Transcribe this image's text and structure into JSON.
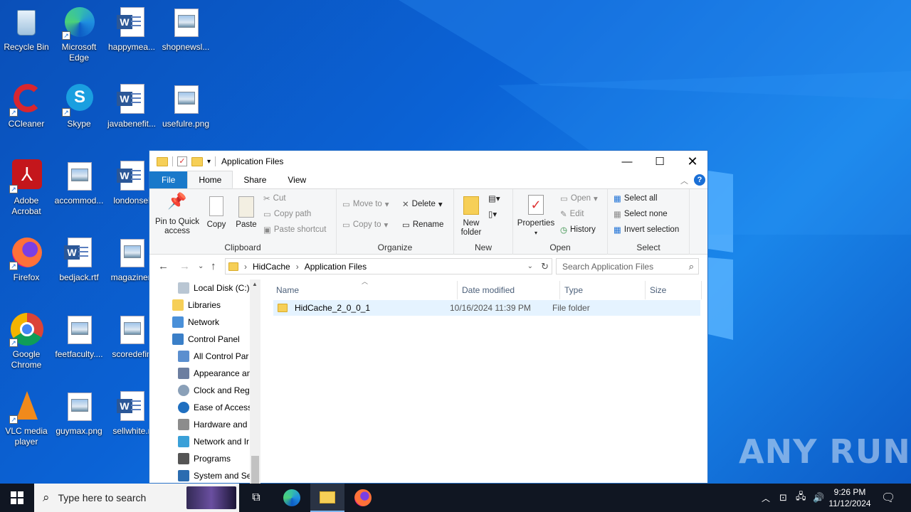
{
  "desktop": {
    "icons": [
      {
        "label": "Recycle Bin"
      },
      {
        "label": "Microsoft Edge"
      },
      {
        "label": "happymea..."
      },
      {
        "label": "shopnewsl..."
      },
      {
        "label": "CCleaner"
      },
      {
        "label": "Skype"
      },
      {
        "label": "javabenefit..."
      },
      {
        "label": "usefulre.png"
      },
      {
        "label": "Adobe Acrobat"
      },
      {
        "label": "accommod..."
      },
      {
        "label": "londonsel"
      },
      {
        "label": "Firefox"
      },
      {
        "label": "bedjack.rtf"
      },
      {
        "label": "magazinen"
      },
      {
        "label": "Google Chrome"
      },
      {
        "label": "feetfaculty...."
      },
      {
        "label": "scoredefin"
      },
      {
        "label": "VLC media player"
      },
      {
        "label": "guymax.png"
      },
      {
        "label": "sellwhite.r"
      }
    ],
    "watermark": "ANY RUN"
  },
  "window": {
    "title": "Application Files",
    "tabs": [
      {
        "label": "File"
      },
      {
        "label": "Home"
      },
      {
        "label": "Share"
      },
      {
        "label": "View"
      }
    ],
    "ribbon": {
      "clipboard": {
        "pin": "Pin to Quick access",
        "copy": "Copy",
        "paste": "Paste",
        "cut": "Cut",
        "copy_path": "Copy path",
        "paste_shortcut": "Paste shortcut",
        "label": "Clipboard"
      },
      "organize": {
        "move_to": "Move to",
        "copy_to": "Copy to",
        "delete": "Delete",
        "rename": "Rename",
        "label": "Organize"
      },
      "new": {
        "new_folder": "New folder",
        "label": "New"
      },
      "open": {
        "properties": "Properties",
        "open": "Open",
        "edit": "Edit",
        "history": "History",
        "label": "Open"
      },
      "select": {
        "select_all": "Select all",
        "select_none": "Select none",
        "invert": "Invert selection",
        "label": "Select"
      }
    },
    "address": {
      "crumbs": [
        "HidCache",
        "Application Files"
      ],
      "search_placeholder": "Search Application Files"
    },
    "nav_pane": [
      {
        "label": "Local Disk (C:)"
      },
      {
        "label": "Libraries"
      },
      {
        "label": "Network"
      },
      {
        "label": "Control Panel"
      },
      {
        "label": "All Control Par"
      },
      {
        "label": "Appearance an"
      },
      {
        "label": "Clock and Regi"
      },
      {
        "label": "Ease of Access"
      },
      {
        "label": "Hardware and"
      },
      {
        "label": "Network and Ir"
      },
      {
        "label": "Programs"
      },
      {
        "label": "System and Se"
      }
    ],
    "columns": [
      "Name",
      "Date modified",
      "Type",
      "Size"
    ],
    "files": [
      {
        "name": "HidCache_2_0_0_1",
        "date": "10/16/2024 11:39 PM",
        "type": "File folder",
        "size": ""
      }
    ]
  },
  "taskbar": {
    "search_placeholder": "Type here to search",
    "time": "9:26 PM",
    "date": "11/12/2024"
  }
}
